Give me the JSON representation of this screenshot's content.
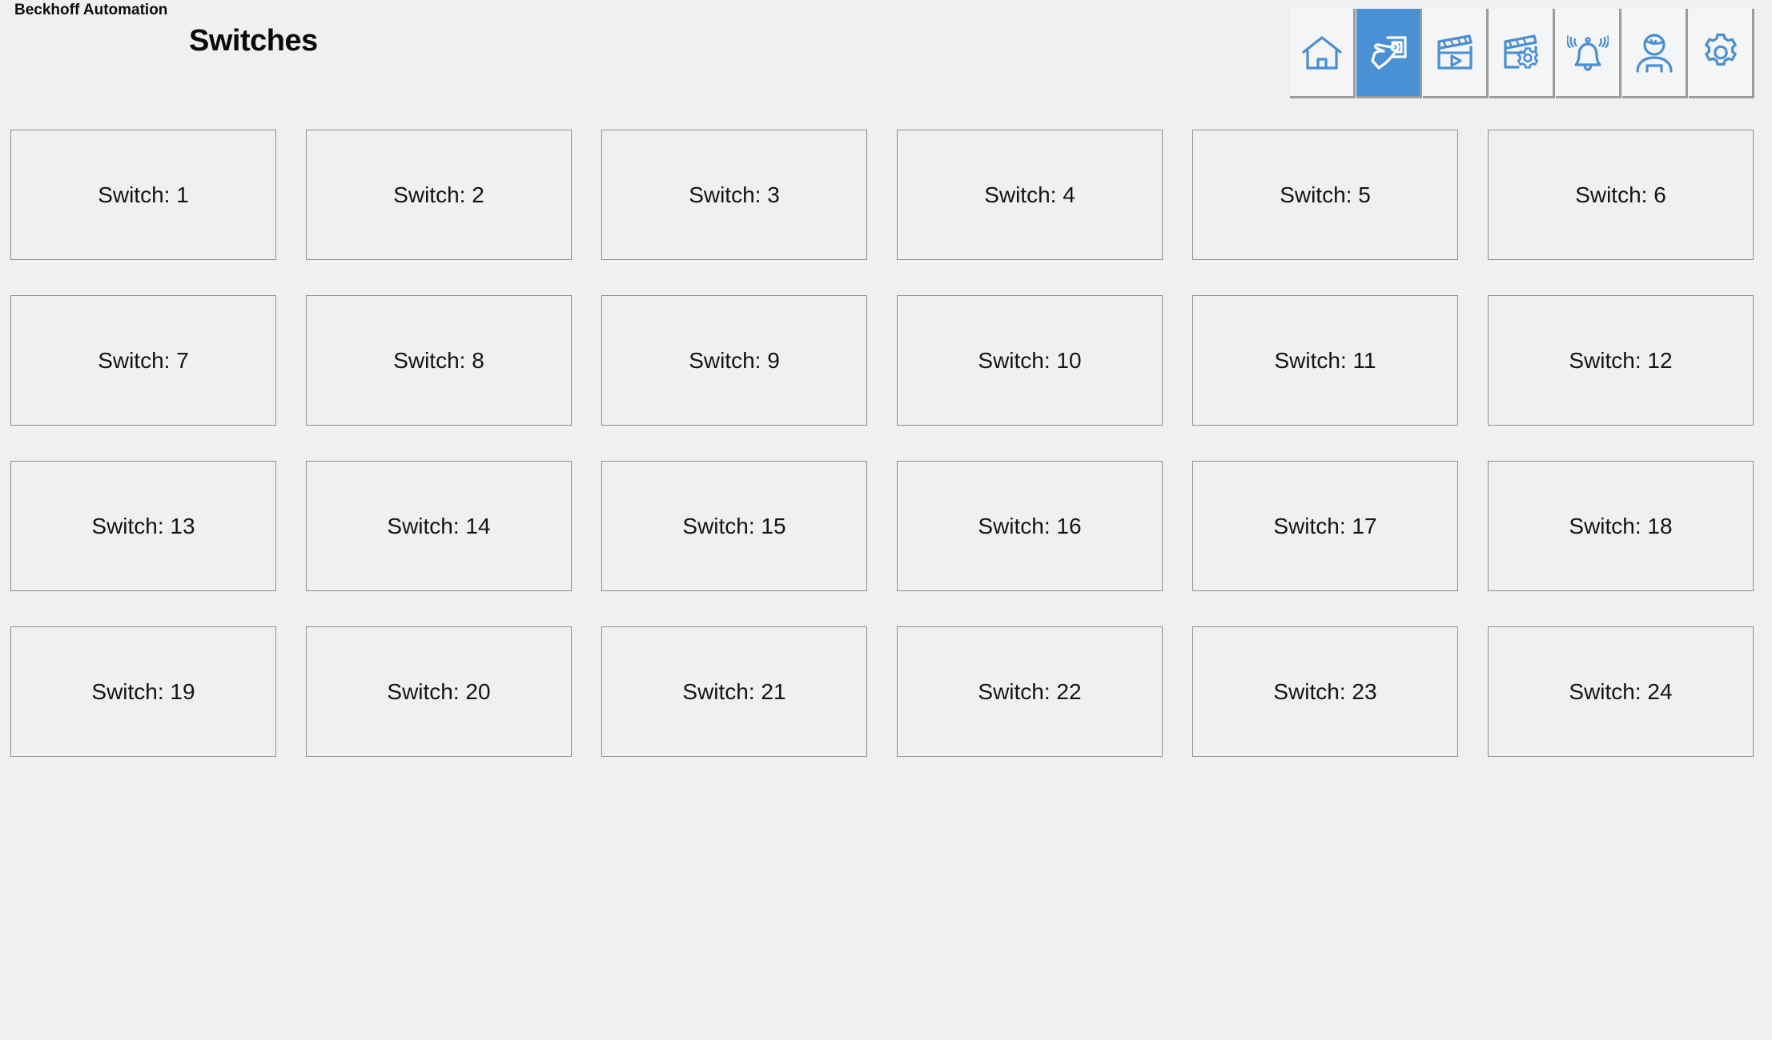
{
  "header": {
    "brand": "Beckhoff Automation",
    "title": "Switches"
  },
  "colors": {
    "background": "#eff0f1",
    "accent_blue": "#4a90d4",
    "icon_blue": "#4a8fd0",
    "tile_border": "#8d8f91",
    "tile_fill": "#eff0f1",
    "button_fill": "#f4f5f6",
    "button_shadow": "#9a9c9e",
    "text": "#141414"
  },
  "toolbar": {
    "buttons": [
      {
        "name": "home-icon",
        "label": "Home",
        "selected": false
      },
      {
        "name": "hand-press-button-icon",
        "label": "Switches",
        "selected": true
      },
      {
        "name": "clapperboard-play-icon",
        "label": "Scenes",
        "selected": false
      },
      {
        "name": "clapperboard-gear-icon",
        "label": "Scene Settings",
        "selected": false
      },
      {
        "name": "alarm-bell-icon",
        "label": "Alarms",
        "selected": false
      },
      {
        "name": "user-icon",
        "label": "User",
        "selected": false
      },
      {
        "name": "gear-icon",
        "label": "Settings",
        "selected": false
      }
    ]
  },
  "grid": {
    "columns": 6,
    "rows": 4,
    "tiles": [
      {
        "label": "Switch: 1"
      },
      {
        "label": "Switch: 2"
      },
      {
        "label": "Switch: 3"
      },
      {
        "label": "Switch: 4"
      },
      {
        "label": "Switch: 5"
      },
      {
        "label": "Switch: 6"
      },
      {
        "label": "Switch: 7"
      },
      {
        "label": "Switch: 8"
      },
      {
        "label": "Switch: 9"
      },
      {
        "label": "Switch: 10"
      },
      {
        "label": "Switch: 11"
      },
      {
        "label": "Switch: 12"
      },
      {
        "label": "Switch: 13"
      },
      {
        "label": "Switch: 14"
      },
      {
        "label": "Switch: 15"
      },
      {
        "label": "Switch: 16"
      },
      {
        "label": "Switch: 17"
      },
      {
        "label": "Switch: 18"
      },
      {
        "label": "Switch: 19"
      },
      {
        "label": "Switch: 20"
      },
      {
        "label": "Switch: 21"
      },
      {
        "label": "Switch: 22"
      },
      {
        "label": "Switch: 23"
      },
      {
        "label": "Switch: 24"
      }
    ]
  }
}
